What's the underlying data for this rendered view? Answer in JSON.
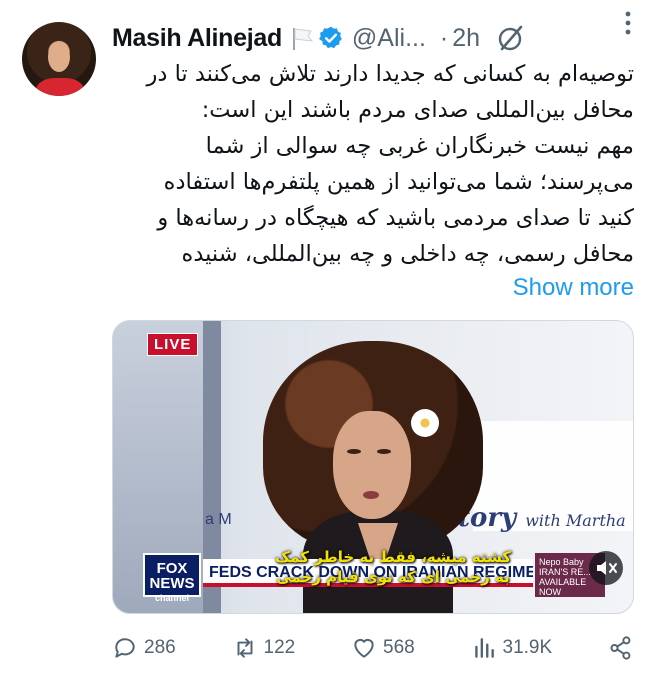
{
  "tweet": {
    "author_name": "Masih Alinejad",
    "handle": "@Ali...",
    "separator": "·",
    "time": "2h",
    "lines": [
      "توصیه‌ام به کسانی که جدیدا دارند تلاش می‌کنند تا در",
      "محافل بین‌المللی صدای مردم باشند این است:",
      "مهم نیست خبرنگاران غربی چه سوالی از شما",
      "می‌پرسند؛ شما می‌توانید از همین پلتفرم‌ها استفاده",
      "کنید تا صدای مردمی باشید که هیچگاه در رسانه‌ها و",
      "محافل رسمی، چه داخلی و چه بین‌المللی، شنیده"
    ],
    "show_more": "Show more"
  },
  "media": {
    "live_badge": "LIVE",
    "studio_text": "tory",
    "studio_text_small": "with Martha",
    "studio_text_left": "a M",
    "subtitle_line1": "کشته میشه، فقط به خاطر کمک",
    "subtitle_line2": "به زخمی ای که توی قیام زخمی",
    "fox_logo_top": "FOX",
    "fox_logo_bottom": "NEWS",
    "fox_logo_sub": "channel",
    "chyron_text": "FEDS CRACK DOWN ON IRANIAN REGIME TIES IN U.S.",
    "side_promo": "Nepo Baby IRAN'S RE... AVAILABLE NOW"
  },
  "actions": {
    "replies": "286",
    "reposts": "122",
    "likes": "568",
    "views": "31.9K"
  },
  "colors": {
    "accent": "#1d9bf0",
    "muted": "#536471",
    "live_red": "#c8102e",
    "fox_blue": "#0a1f63"
  }
}
